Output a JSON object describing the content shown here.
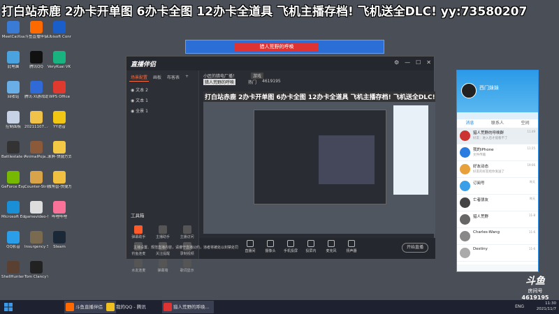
{
  "banner": "打白站赤鹿 2办卡开单图 6办卡全图 12办卡全道具 飞机主播存档! 飞机送全DLC! yy:73580207",
  "desktop_icons": [
    {
      "label": "MeetCaiXsa",
      "color": "#3a7bd5"
    },
    {
      "label": "斗鱼直播伴侣",
      "color": "#ff6a00"
    },
    {
      "label": "Ubisoft Connect",
      "color": "#1a5fc9"
    },
    {
      "label": "此电脑",
      "color": "#4aa3df"
    },
    {
      "label": "腾讯QQ",
      "color": "#111"
    },
    {
      "label": "VeryKuai VK 游戏加速器",
      "color": "#18b37e"
    },
    {
      "label": "回收站",
      "color": "#6aaee8"
    },
    {
      "label": "腾讯·XI游戏助手",
      "color": "#2f6ad6"
    },
    {
      "label": "WPS Office",
      "color": "#e03a2f"
    },
    {
      "label": "控制面板",
      "color": "#c8d2e6"
    },
    {
      "label": "20211107...-快捷方式",
      "color": "#f0c24a"
    },
    {
      "label": "YY语音",
      "color": "#f2c713"
    },
    {
      "label": "Battlestate Games L...",
      "color": "#333"
    },
    {
      "label": "AnimalPoja...-快捷方式",
      "color": "#8a5a3a"
    },
    {
      "label": "滚屏-快捷方式",
      "color": "#f3c845"
    },
    {
      "label": "GeForce Experience",
      "color": "#76b900"
    },
    {
      "label": "Counter-Strike Global Off...",
      "color": "#d9a34a"
    },
    {
      "label": "独角兽-快捷方式",
      "color": "#f1c040"
    },
    {
      "label": "Microsoft Edge",
      "color": "#1b8fd6"
    },
    {
      "label": "gamevideo-快捷方式",
      "color": "#ddd"
    },
    {
      "label": "哔哩哔哩",
      "color": "#fb7299"
    },
    {
      "label": "QQ影音",
      "color": "#2a9ee8"
    },
    {
      "label": "Insurgency Sandstorm",
      "color": "#7a6a50"
    },
    {
      "label": "Steam",
      "color": "#1b2838"
    },
    {
      "label": "ShellHunter Call of s...",
      "color": "#5a4030"
    },
    {
      "label": "Tom Clancy's R...",
      "color": "#222"
    }
  ],
  "blue_bar": {
    "title": "猎人荒野的呼唤"
  },
  "app": {
    "logo": "直播伴侣",
    "tabs": [
      "场景配置",
      "画板",
      "布客表"
    ],
    "add_icon": "+",
    "scenes": [
      "文本 2",
      "文本 1",
      "全景 1"
    ],
    "tools_title": "工具箱",
    "tools": [
      {
        "label": "弹幕助手",
        "hot": true
      },
      {
        "label": "主播助手",
        "hot": false
      },
      {
        "label": "主播访问",
        "hot": false
      },
      {
        "label": "钓鱼连麦",
        "hot": false
      },
      {
        "label": "关注提醒",
        "hot": false
      },
      {
        "label": "录制视频",
        "hot": false
      },
      {
        "label": "水友连麦",
        "hot": false
      },
      {
        "label": "弹幕墙",
        "hot": false
      },
      {
        "label": "歌词显示",
        "hot": false
      }
    ],
    "main_header_title": "小匠的猎电厂播！",
    "main_header_tag": "游戏",
    "room_title": "猎人荒野的呼唤",
    "room_id": "4619195",
    "hot_label": "热门",
    "preview_caption": "打白站赤鹿 2办卡开单图 6办卡全图 12办卡全道具 飞机主播存档! 飞机送全DLC! yy:73580207",
    "controls": [
      "直播间",
      "摄像头",
      "手机投屏",
      "投屏内",
      "麦克风",
      "扬声器"
    ],
    "start_button": "开始直播",
    "notice": "主播设置、规范直播内容，请遵守直播公约，违者将被处以封禁处罚"
  },
  "qq": {
    "username": "西门妹妹",
    "tabs": [
      "消息",
      "联系人",
      "空间"
    ],
    "items": [
      {
        "name": "猎人荒野的呼唤群",
        "sub": "好友：进入后才能看不了",
        "time": "11:49"
      },
      {
        "name": "我的iPhone",
        "sub": "文件传输",
        "time": "11:25"
      },
      {
        "name": "好友动态",
        "sub": "好友的好友给你发送了",
        "time": "19:06"
      },
      {
        "name": "订阅号",
        "sub": "",
        "time": "昨天"
      },
      {
        "name": "亡者朋友",
        "sub": "",
        "time": "昨天"
      },
      {
        "name": "猎人荒野",
        "sub": "",
        "time": "11-8"
      },
      {
        "name": "Charles-Wang",
        "sub": "",
        "time": "11-6"
      },
      {
        "name": "Destiny",
        "sub": "",
        "time": "11-6"
      }
    ]
  },
  "watermark": {
    "logo": "斗鱼",
    "room": "房间号",
    "number": "4619195"
  },
  "taskbar": {
    "items": [
      {
        "label": "斗鱼直播伴侣",
        "color": "#ff6a00",
        "active": true
      },
      {
        "label": "我的QQ - 腾讯",
        "color": "#f0c020",
        "active": false
      },
      {
        "label": "猎人荒野的呼唤...",
        "color": "#d33",
        "active": true
      }
    ],
    "lang": "ENG",
    "time": "11:30",
    "date": "2021/11/7"
  }
}
